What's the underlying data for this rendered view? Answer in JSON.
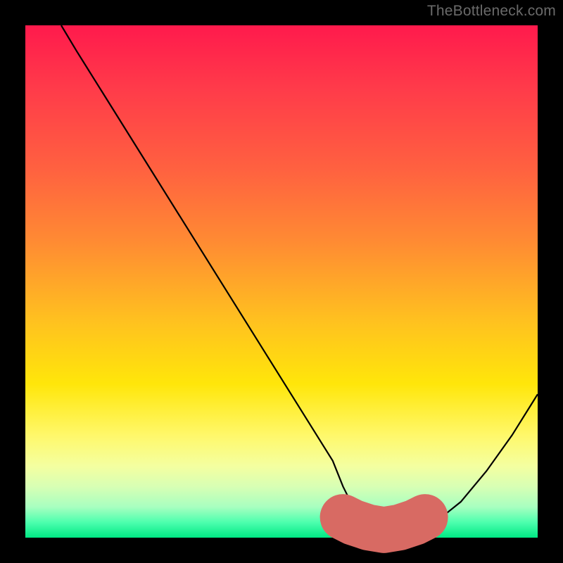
{
  "attribution": "TheBottleneck.com",
  "chart_data": {
    "type": "line",
    "title": "",
    "xlabel": "",
    "ylabel": "",
    "xlim": [
      0,
      100
    ],
    "ylim": [
      0,
      100
    ],
    "series": [
      {
        "name": "bottleneck-curve",
        "x": [
          7,
          10,
          15,
          20,
          25,
          30,
          35,
          40,
          45,
          50,
          55,
          60,
          62,
          64,
          67,
          70,
          73,
          76,
          80,
          85,
          90,
          95,
          100
        ],
        "values": [
          100,
          95,
          87,
          79,
          71,
          63,
          55,
          47,
          39,
          31,
          23,
          15,
          10,
          6,
          3,
          1.5,
          1,
          1.5,
          3,
          7,
          13,
          20,
          28
        ]
      },
      {
        "name": "optimal-highlight",
        "x": [
          62,
          64,
          67,
          70,
          73,
          76,
          78
        ],
        "values": [
          4,
          3,
          2,
          1.5,
          2,
          3,
          4
        ]
      }
    ],
    "colors": {
      "curve": "#000000",
      "highlight": "#d86a63"
    }
  }
}
